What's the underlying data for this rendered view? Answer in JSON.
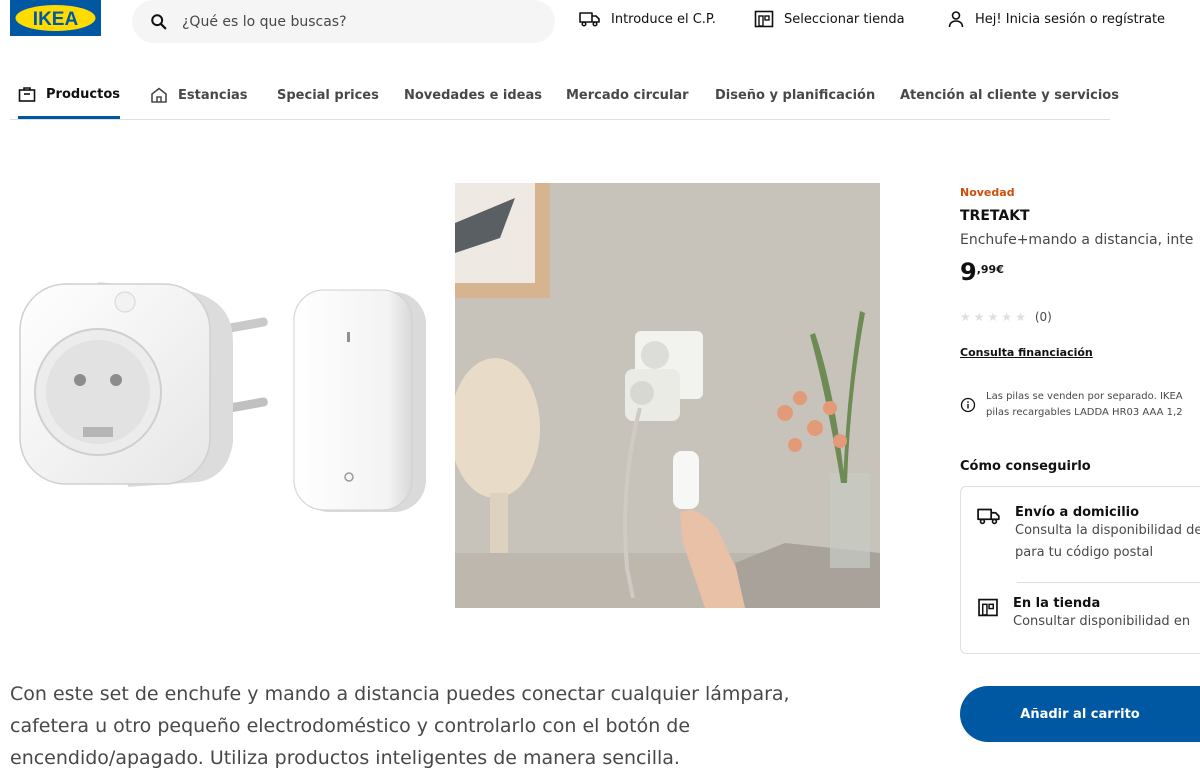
{
  "header": {
    "logo_text": "IKEA",
    "search_placeholder": "¿Qué es lo que buscas?",
    "postal_code_label": "Introduce el C.P.",
    "store_label": "Seleccionar tienda",
    "login_label": "Hej! Inicia sesión o regístrate"
  },
  "nav": {
    "items": [
      {
        "label": "Productos",
        "icon": "bag-icon"
      },
      {
        "label": "Estancias",
        "icon": "house-icon"
      },
      {
        "label": "Special prices"
      },
      {
        "label": "Novedades e ideas"
      },
      {
        "label": "Mercado circular"
      },
      {
        "label": "Diseño y planificación"
      },
      {
        "label": "Atención al cliente y servicios"
      }
    ]
  },
  "product": {
    "badge": "Novedad",
    "name": "TRETAKT",
    "description": "Enchufe+mando a distancia, inte",
    "price_integer": "9",
    "price_decimal": ",99€",
    "rating_count": "(0)",
    "rating": 0,
    "financing_link": "Consulta financiación",
    "battery_note_line1": "Las pilas se venden por separado. IKEA",
    "battery_note_line2": "pilas recargables LADDA HR03 AAA 1,2"
  },
  "availability": {
    "heading": "Cómo conseguirlo",
    "delivery_title": "Envío a domicilio",
    "delivery_sub_line1": "Consulta la disponibilidad de",
    "delivery_sub_line2": "para tu código postal",
    "store_title": "En la tienda",
    "store_sub": "Consultar disponibilidad en"
  },
  "cart_button_label": "Añadir al carrito",
  "long_description": "Con este set de enchufe y mando a distancia puedes conectar cualquier lámpara, cafetera u otro pequeño electrodoméstico y controlarlo con el botón de encendido/apagado. Utiliza productos inteligentes de manera sencilla.",
  "colors": {
    "brand_blue": "#0058a3",
    "brand_yellow": "#ffdb00",
    "badge_orange": "#ca5008"
  }
}
